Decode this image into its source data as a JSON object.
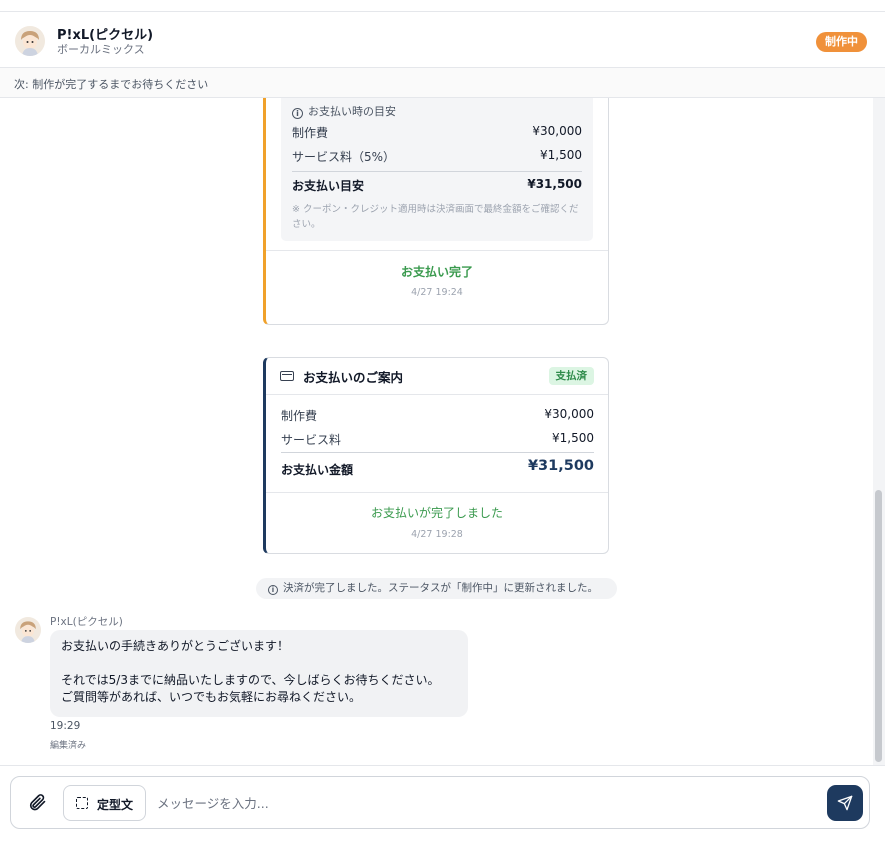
{
  "header": {
    "name": "P!xL(ピクセル)",
    "subtitle": "ボーカルミックス",
    "status": "制作中",
    "status_color": "#f0913a"
  },
  "next_step": "次: 制作が完了するまでお待ちください",
  "estimate_card": {
    "title": "お支払い時の目安",
    "rows": [
      {
        "label": "制作費",
        "value": "¥30,000"
      },
      {
        "label": "サービス料（5%）",
        "value": "¥1,500"
      }
    ],
    "total_label": "お支払い目安",
    "total_value": "¥31,500",
    "note": "※ クーポン・クレジット適用時は決済画面で最終金額をご確認ください。",
    "status": "お支払い完了",
    "time": "4/27 19:24",
    "accent": "#f0a12a"
  },
  "payment_card": {
    "title": "お支払いのご案内",
    "badge": "支払済",
    "rows": [
      {
        "label": "制作費",
        "value": "¥30,000"
      },
      {
        "label": "サービス料",
        "value": "¥1,500"
      }
    ],
    "total_label": "お支払い金額",
    "total_value": "¥31,500",
    "status": "お支払いが完了しました",
    "time": "4/27 19:28",
    "accent": "#1e3a5f"
  },
  "system_message": "決済が完了しました。ステータスが「制作中」に更新されました。",
  "message": {
    "sender": "P!xL(ピクセル)",
    "line1": "お支払いの手続きありがとうございます！",
    "line2": "それでは5/3までに納品いたしますので、今しばらくお待ちください。",
    "line3": "ご質問等があれば、いつでもお気軽にお尋ねください。",
    "time": "19:29",
    "edited": "編集済み"
  },
  "composer": {
    "template_label": "定型文",
    "placeholder": "メッセージを入力...",
    "value": ""
  },
  "icons": {
    "attach": "paperclip-icon",
    "template": "dashed-square-icon",
    "send": "send-icon",
    "info": "info-icon",
    "card": "credit-card-icon"
  }
}
